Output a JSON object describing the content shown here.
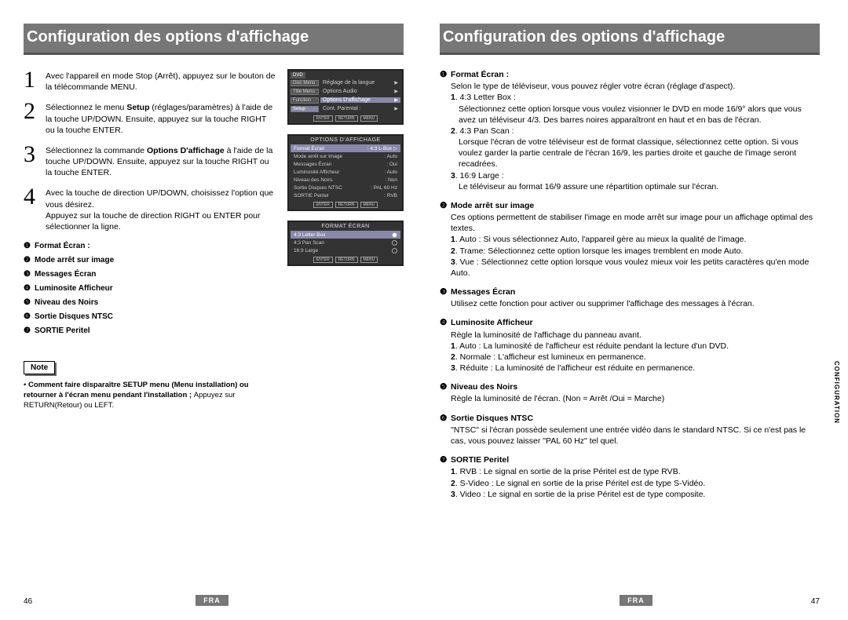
{
  "banner": {
    "left": "Configuration des options d'affichage",
    "right": "Configuration des options d'affichage"
  },
  "steps": [
    {
      "num": "1",
      "text": "Avec l'appareil en mode Stop (Arrêt), appuyez sur le bouton de la télécommande MENU."
    },
    {
      "num": "2",
      "pre": "Sélectionnez le menu ",
      "bold": "Setup",
      "post": " (réglages/paramètres) à l'aide de la touche UP/DOWN. Ensuite, appuyez sur la touche RIGHT ou la touche ENTER."
    },
    {
      "num": "3",
      "pre": "Sélectionnez la commande ",
      "bold": "Options D'affichage",
      "post": " à l'aide de la touche UP/DOWN. Ensuite, appuyez sur la touche RIGHT ou la touche ENTER."
    },
    {
      "num": "4",
      "text": "Avec la touche de direction UP/DOWN, choisissez l'option que vous désirez.",
      "text2": "Appuyez sur la touche de direction RIGHT ou ENTER pour sélectionner la ligne."
    }
  ],
  "quick_options": [
    {
      "bullet": "❶",
      "label": "Format Écran :"
    },
    {
      "bullet": "❷",
      "label": "Mode arrêt sur image"
    },
    {
      "bullet": "❸",
      "label": "Messages Écran"
    },
    {
      "bullet": "❹",
      "label": "Luminosite Afficheur"
    },
    {
      "bullet": "❺",
      "label": "Niveau des Noirs"
    },
    {
      "bullet": "❻",
      "label": "Sortie Disques NTSC"
    },
    {
      "bullet": "❼",
      "label": "SORTIE Peritel"
    }
  ],
  "osd1": {
    "topbar": "DVD",
    "tabs": [
      "Disc Menu",
      "Title Menu",
      "Function",
      "Setup"
    ],
    "rows": [
      {
        "label": "Réglage de la langue",
        "arrow": "▶"
      },
      {
        "label": "Options Audio",
        "arrow": "▶"
      },
      {
        "label": "Options D'affichage",
        "arrow": "▶",
        "sel": true
      },
      {
        "label": "Cont. Parental : ",
        "arrow": "▶"
      }
    ],
    "buttons": [
      "ENTER",
      "RETURN",
      "MENU"
    ]
  },
  "osd2": {
    "title": "OPTIONS D'AFFICHAGE",
    "rows": [
      {
        "l": "Format Écran",
        "r": ": 4:3 L-Box ▷",
        "sel": true
      },
      {
        "l": "Mode arrêt sur Image",
        "r": ": Auto"
      },
      {
        "l": "Messages Écran",
        "r": ": Oui"
      },
      {
        "l": "Luminosité Afficheur",
        "r": ": Auto"
      },
      {
        "l": "Niveau des Noirs",
        "r": ": Non"
      },
      {
        "l": "Sortie Disques NTSC",
        "r": ": PAL 60 Hz"
      },
      {
        "l": "SORTIE Peritel",
        "r": ": RVB"
      }
    ],
    "buttons": [
      "ENTER",
      "RETURN",
      "MENU"
    ]
  },
  "osd3": {
    "title": "FORMAT ÉCRAN",
    "rows": [
      {
        "l": "4:3 Letter Box",
        "sel": true
      },
      {
        "l": "4:3 Pan Scan"
      },
      {
        "l": "16:9 Large"
      }
    ],
    "buttons": [
      "ENTER",
      "RETURN",
      "MENU"
    ]
  },
  "note": {
    "label": "Note",
    "dot": "•",
    "bold": "Comment faire disparaître SETUP menu (Menu installation) ou retourner à l'écran menu pendant l'installation ; ",
    "rest": "Appuyez sur RETURN(Retour) ou LEFT."
  },
  "right_items": [
    {
      "n": "❶",
      "title": "Format Écran :",
      "desc": "Selon le type de téléviseur, vous pouvez régler votre écran (réglage d'aspect).",
      "subs": [
        {
          "sn": "1",
          "st": ". 4:3 Letter Box :",
          "sb": "Sélectionnez cette option lorsque vous voulez visionner le DVD en mode 16/9° alors que vous avez un téléviseur 4/3. Des barres noires apparaîtront en haut et en bas de l'écran."
        },
        {
          "sn": "2",
          "st": ". 4:3 Pan Scan :",
          "sb": "Lorsque l'écran de votre téléviseur est de format classique, sélectionnez cette option. Si vous voulez garder la partie centrale de l'écran 16/9, les parties droite et gauche de l'image seront recadrées."
        },
        {
          "sn": "3",
          "st": ". 16:9 Large :",
          "sb": "Le téléviseur au format 16/9 assure une répartition optimale sur l'écran."
        }
      ]
    },
    {
      "n": "❷",
      "title": "Mode arrêt sur image",
      "desc": "Ces options permettent de stabiliser l'image en mode arrêt sur image pour un affichage optimal des textes.",
      "subs": [
        {
          "sn": "1",
          "st": ". Auto : Si vous sélectionnez Auto, l'appareil gère au mieux la qualité de l'image."
        },
        {
          "sn": "2",
          "st": ". Trame: Sélectionnez cette option lorsque les images tremblent en mode Auto."
        },
        {
          "sn": "3",
          "st": ". Vue : Sélectionnez cette option lorsque vous voulez mieux voir les petits caractères qu'en mode Auto."
        }
      ]
    },
    {
      "n": "❸",
      "title": "Messages Écran",
      "desc": "Utilisez cette fonction pour activer ou supprimer l'affichage des messages à l'écran."
    },
    {
      "n": "❹",
      "title": "Luminosite Afficheur",
      "desc": "Règle la luminosité de l'affichage du panneau avant.",
      "subs": [
        {
          "sn": "1",
          "st": ". Auto : La luminosité de l'afficheur est réduite pendant la lecture d'un DVD."
        },
        {
          "sn": "2",
          "st": ". Normale : L'afficheur est lumineux en permanence."
        },
        {
          "sn": "3",
          "st": ". Réduite : La luminosité de l'afficheur est réduite en permanence."
        }
      ]
    },
    {
      "n": "❺",
      "title": "Niveau des Noirs",
      "desc": "Règle la luminosité de l'écran. (Non =  Arrêt /Oui = Marche)"
    },
    {
      "n": "❻",
      "title": "Sortie Disques NTSC",
      "desc": "\"NTSC\" si l'écran possède seulement une entrée vidéo dans le standard NTSC. Si ce n'est pas le cas, vous pouvez laisser \"PAL 60 Hz\" tel quel."
    },
    {
      "n": "❼",
      "title": "SORTIE Peritel",
      "subs": [
        {
          "sn": "1",
          "st": ". RVB : Le signal en sortie de la prise Péritel est de type RVB."
        },
        {
          "sn": "2",
          "st": ". S-Video : Le signal en sortie de la prise Péritel est de type S-Vidéo."
        },
        {
          "sn": "3",
          "st": ". Video : Le signal en sortie de la prise Péritel est de type composite."
        }
      ]
    }
  ],
  "footer": {
    "lang": "FRA",
    "left_page": "46",
    "right_page": "47"
  },
  "sidelabel": "CONFIGURATION"
}
